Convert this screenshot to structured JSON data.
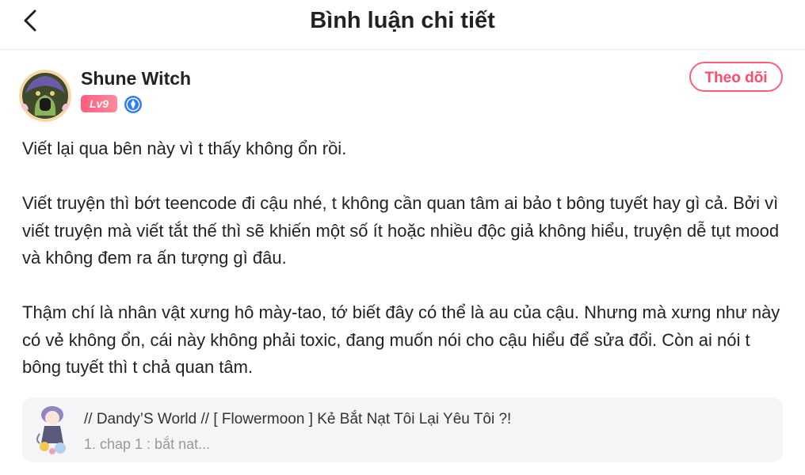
{
  "header": {
    "title": "Bình luận chi tiết",
    "back_icon": "chevron-left-icon"
  },
  "author": {
    "name": "Shune Witch",
    "level": "Lv9",
    "verify_icon": "verified-badge-icon",
    "follow_label": "Theo dõi"
  },
  "comment": {
    "paragraphs": [
      "Viết lại qua bên này vì t thấy không ổn rồi.",
      "Viết truyện thì bớt teencode đi cậu nhé, t không cần quan tâm ai bảo t bông tuyết hay gì cả. Bởi vì viết truyện mà viết tắt thế thì sẽ khiến một số ít hoặc nhiều độc giả không hiểu, truyện dễ tụt mood và không đem ra ấn tượng gì đâu.",
      "Thậm chí là nhân vật xưng hô mày-tao, tớ biết đây có thể là au của cậu. Nhưng mà xưng như này có vẻ không ổn, cái này không phải toxic, đang muốn nói cho cậu hiểu để sửa đổi. Còn ai nói t bông tuyết thì t chả quan tâm."
    ]
  },
  "story": {
    "title": "// Dandy’S World // [ Flowermoon ] Kẻ Bắt Nạt Tôi Lại Yêu Tôi ?!",
    "chapter": "1. chap 1 : bắt nat..."
  },
  "colors": {
    "accent": "#ff4a6e",
    "verify": "#2f7cf6",
    "card_bg": "#f5f5f7"
  }
}
